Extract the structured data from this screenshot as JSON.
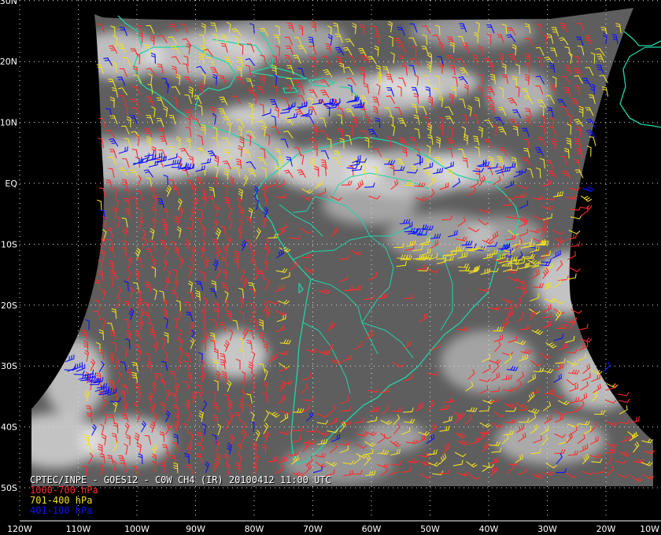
{
  "map": {
    "lon_range": [
      -120,
      -10
    ],
    "lat_range": [
      -53,
      30
    ],
    "grid": true,
    "lat_labels": [
      "30N",
      "20N",
      "10N",
      "EQ",
      "10S",
      "20S",
      "30S",
      "40S",
      "50S"
    ],
    "lon_labels": [
      "120W",
      "110W",
      "100W",
      "90W",
      "80W",
      "70W",
      "60W",
      "50W",
      "40W",
      "30W",
      "20W",
      "10W"
    ],
    "colors": {
      "background": "#000000",
      "imagery": "#606060",
      "cloud": "#e6e6e6",
      "coastline": "#20d4a8",
      "grid": "#e0e0e0",
      "low_level": "#ff2a2a",
      "mid_level": "#f0e020",
      "high_level": "#1010ff"
    }
  },
  "caption": {
    "title": "CPTEC/INPE - GOES12 - C0W CH4 (IR) 20100412 11:00 UTC",
    "legend": [
      {
        "label": "1000-700 hPa",
        "color": "#ff2a2a"
      },
      {
        "label": "701-400 hPa",
        "color": "#f0e020"
      },
      {
        "label": "401-100 hPa",
        "color": "#1010ff"
      }
    ]
  }
}
